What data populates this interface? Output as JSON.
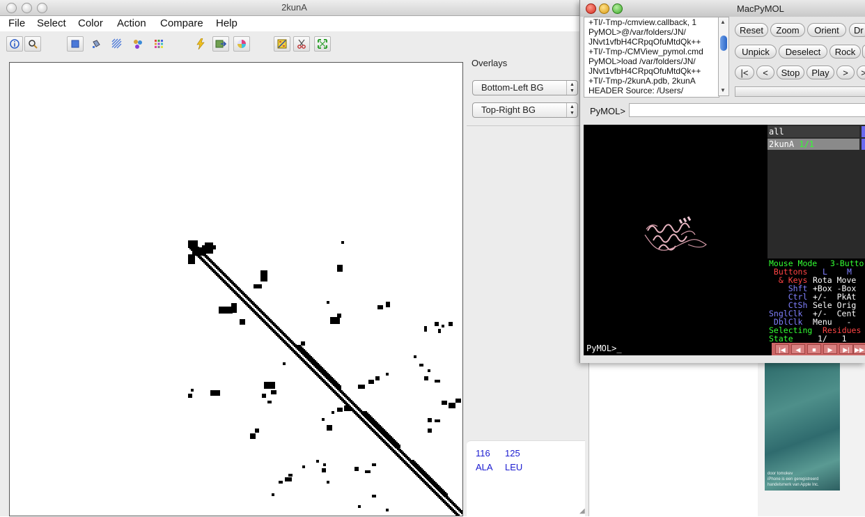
{
  "cmview": {
    "window_title": "2kunA",
    "menus": [
      "File",
      "Select",
      "Color",
      "Action",
      "Compare",
      "Help"
    ],
    "overlays": {
      "heading": "Overlays",
      "bottom_left": "Bottom-Left BG",
      "top_right": "Top-Right BG"
    },
    "residue_info": {
      "residue_1_number": "116",
      "residue_2_number": "125",
      "residue_1_name": "ALA",
      "residue_2_name": "LEU"
    }
  },
  "pymol": {
    "window_title": "MacPyMOL",
    "log_lines": [
      "+Tl/-Tmp-/cmview.callback, 1",
      "PyMOL>@/var/folders/JN/",
      "JNvt1vfbH4CRpqOfuMtdQk++",
      "+Tl/-Tmp-/CMView_pymol.cmd",
      "PyMOL>load /var/folders/JN/",
      "JNvt1vfbH4CRpqOfuMtdQk++",
      "+Tl/-Tmp-/2kunA.pdb, 2kunA",
      "HEADER  Source: /Users/"
    ],
    "buttons_row1": [
      "Reset",
      "Zoom",
      "Orient",
      "Dr"
    ],
    "buttons_row2": [
      "Unpick",
      "Deselect",
      "Rock"
    ],
    "buttons_row3": [
      "|<",
      "<",
      "Stop",
      "Play",
      ">",
      ">"
    ],
    "command_prompt_label": "PyMOL>",
    "objects": [
      {
        "name": "all",
        "extra": ""
      },
      {
        "name": "2kunA",
        "extra": "1/1"
      }
    ],
    "mouse_info": {
      "mode_label": "Mouse Mode",
      "mode_value": "3-Butto",
      "buttons_label": " Buttons",
      "buttons_l": "L",
      "buttons_m": "M",
      "keys_label": "  & Keys",
      "keys_values": "Rota Move",
      "shft_label": "    Shft",
      "shft_values": "+Box -Box",
      "ctrl_label": "    Ctrl",
      "ctrl_values": "+/-  PkAt",
      "ctsh_label": "    CtSh",
      "ctsh_values": "Sele Orig",
      "snglclk_label": "SnglClk",
      "snglclk_values": "+/-  Cent",
      "dblclk_label": " DblClk",
      "dblclk_values": "Menu   -",
      "selecting_label": "Selecting",
      "selecting_value": "Residues",
      "state_label": "State",
      "state_value": "1/   1"
    },
    "bottom_prompt": "PyMOL>_"
  },
  "background_ad": {
    "credit": "door tomokev",
    "line2": "iPhone is een geregistreerd",
    "line3": "handelsmerk van Apple Inc."
  },
  "colors": {
    "contact": "#000000",
    "residue_text": "#1a1ad0",
    "pymol_green": "#33ff33",
    "pymol_red": "#ff4444",
    "pymol_blue": "#8080ff"
  },
  "icons": [
    "info-icon",
    "zoom-icon",
    "square-select-icon",
    "fill-icon",
    "diagonal-select-icon",
    "node-select-icon",
    "color-grid-icon",
    "lightning-icon",
    "export-icon",
    "color-wheel-icon",
    "compare-icon",
    "scissors-icon",
    "expand-icon"
  ]
}
